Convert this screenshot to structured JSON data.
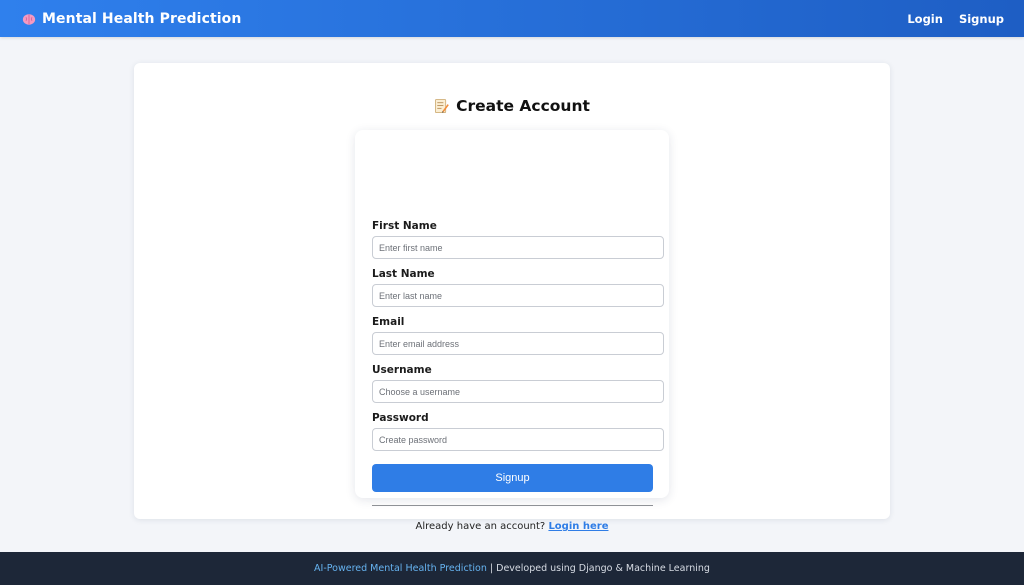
{
  "navbar": {
    "brand_icon": "brain-icon",
    "brand_title": "Mental Health Prediction",
    "links": {
      "login": "Login",
      "signup": "Signup"
    }
  },
  "page": {
    "title_icon": "memo-icon",
    "title": "Create Account"
  },
  "form": {
    "fields": [
      {
        "label": "First Name",
        "placeholder": "Enter first name",
        "value": ""
      },
      {
        "label": "Last Name",
        "placeholder": "Enter last name",
        "value": ""
      },
      {
        "label": "Email",
        "placeholder": "Enter email address",
        "value": ""
      },
      {
        "label": "Username",
        "placeholder": "Choose a username",
        "value": ""
      },
      {
        "label": "Password",
        "placeholder": "Create password",
        "value": ""
      }
    ],
    "submit_label": "Signup",
    "login_prompt": "Already have an account?",
    "login_link": "Login here"
  },
  "footer": {
    "accent_text": "AI-Powered Mental Health Prediction",
    "separator": " | ",
    "rest_text": "Developed using Django & Machine Learning"
  },
  "colors": {
    "navbar_start": "#2f80ed",
    "navbar_end": "#1e5ec4",
    "accent": "#2f7de6",
    "footer_bg": "#1d2738",
    "footer_accent": "#66b3f0",
    "page_bg": "#f3f5f9"
  }
}
